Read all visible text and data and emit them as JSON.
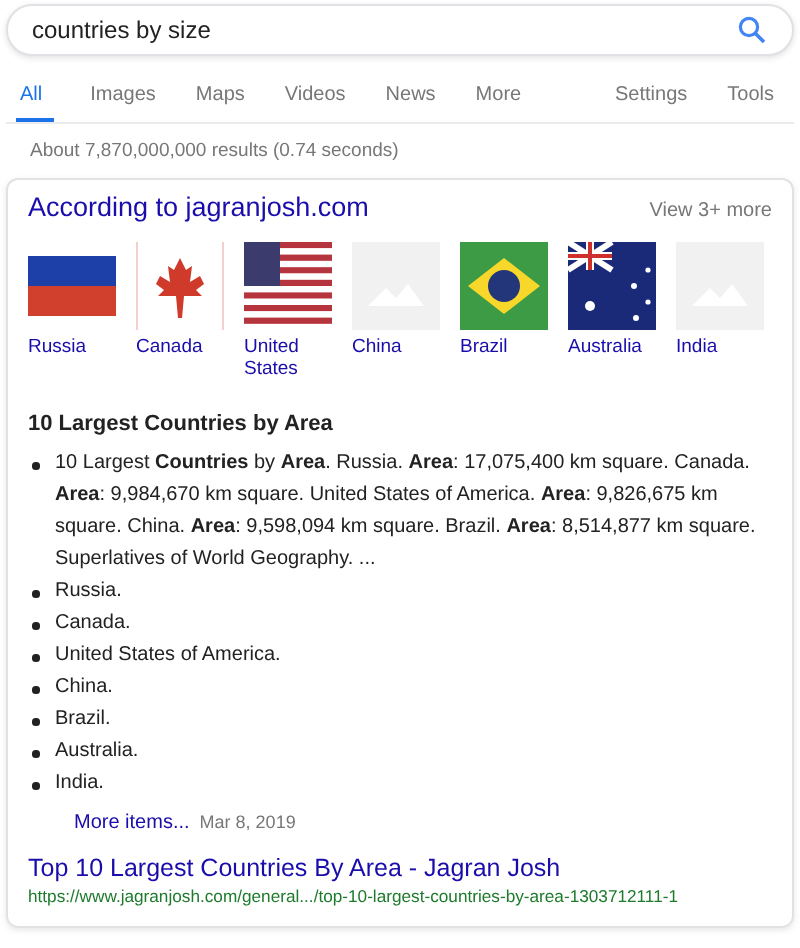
{
  "search": {
    "value": "countries by size"
  },
  "tabs": [
    {
      "label": "All",
      "selected": true
    },
    {
      "label": "Images",
      "selected": false
    },
    {
      "label": "Maps",
      "selected": false
    },
    {
      "label": "Videos",
      "selected": false
    },
    {
      "label": "News",
      "selected": false
    },
    {
      "label": "More",
      "selected": false
    }
  ],
  "tools": [
    "Settings",
    "Tools"
  ],
  "result_stats": "About 7,870,000,000 results (0.74 seconds)",
  "card": {
    "title": "According to jagranjosh.com",
    "view_more": "View 3+ more",
    "images": [
      {
        "kind": "russia",
        "label": "Russia"
      },
      {
        "kind": "canada",
        "label": "Canada"
      },
      {
        "kind": "usa",
        "label": "United States"
      },
      {
        "kind": "placeholder",
        "label": "China"
      },
      {
        "kind": "brazil",
        "label": "Brazil"
      },
      {
        "kind": "australia",
        "label": "Australia"
      },
      {
        "kind": "placeholder",
        "label": "India"
      }
    ],
    "heading": "10 Largest Countries by Area",
    "bullets": [
      "10 Largest **Countries** by **Area**. Russia. **Area**: 17,075,400 km square. Canada. **Area**: 9,984,670 km square. United States of America. **Area**: 9,826,675 km square. China. **Area**: 9,598,094 km square. Brazil. **Area**: 8,514,877 km square. Superlatives of World Geography. ...",
      "Russia.",
      "Canada.",
      "United States of America.",
      "China.",
      "Brazil.",
      "Australia.",
      "India."
    ],
    "more_link": "More items...",
    "date": "Mar 8, 2019",
    "result_title": "Top 10 Largest Countries By Area - Jagran Josh",
    "result_url": "https://www.jagranjosh.com/general.../top-10-largest-countries-by-area-1303712111-1"
  }
}
